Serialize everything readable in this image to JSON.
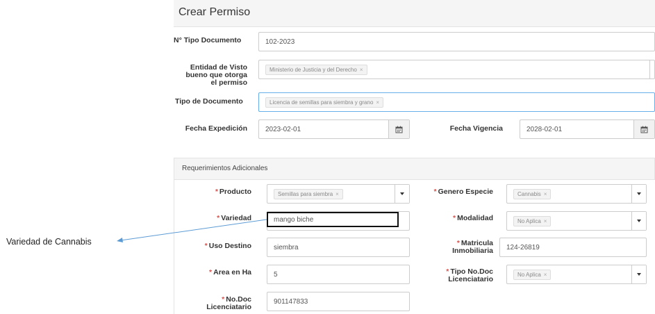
{
  "header": {
    "title": "Crear Permiso"
  },
  "form": {
    "tipo_documento_num": {
      "label": "N° Tipo Documento",
      "value": "102-2023"
    },
    "entidad": {
      "label_l1": "Entidad de Visto",
      "label_l2": "bueno que otorga",
      "label_l3": "el permiso",
      "tag": "Ministerio de Justicia y del Derecho"
    },
    "tipo_documento": {
      "label": "Tipo de Documento",
      "tag": "Licencia de semillas para siembra y grano"
    },
    "fecha_expedicion": {
      "label": "Fecha Expedición",
      "value": "2023-02-01"
    },
    "fecha_vigencia": {
      "label": "Fecha Vigencia",
      "value": "2028-02-01"
    }
  },
  "additional": {
    "title": "Requerimientos Adicionales",
    "producto": {
      "label": "Producto",
      "tag": "Semillas para siembra"
    },
    "genero": {
      "label": "Genero Especie",
      "tag": "Cannabis"
    },
    "variedad": {
      "label": "Variedad",
      "value": "mango biche"
    },
    "modalidad": {
      "label": "Modalidad",
      "tag": "No Aplica"
    },
    "uso_destino": {
      "label": "Uso Destino",
      "value": "siembra"
    },
    "matricula": {
      "label_l1": "Matricula",
      "label_l2": "Inmobiliaria",
      "value": "124-26819"
    },
    "area": {
      "label": "Area en Ha",
      "value": "5"
    },
    "tipo_nodoc": {
      "label_l1": "Tipo No.Doc",
      "label_l2": "Licenciatario",
      "tag": "No Aplica"
    },
    "nodoc": {
      "label_l1": "No.Doc",
      "label_l2": "Licenciatario",
      "value": "901147833"
    }
  },
  "annotation": {
    "text": "Variedad de Cannabis"
  },
  "icons": {
    "calendar": "calendar-icon",
    "tag_remove": "×",
    "dropdown": "chevron-down-icon"
  },
  "colors": {
    "required": "#d9534f",
    "focus_border": "#66afe9",
    "annotation_box": "#111111",
    "annotation_arrow": "#5b9bd5"
  }
}
